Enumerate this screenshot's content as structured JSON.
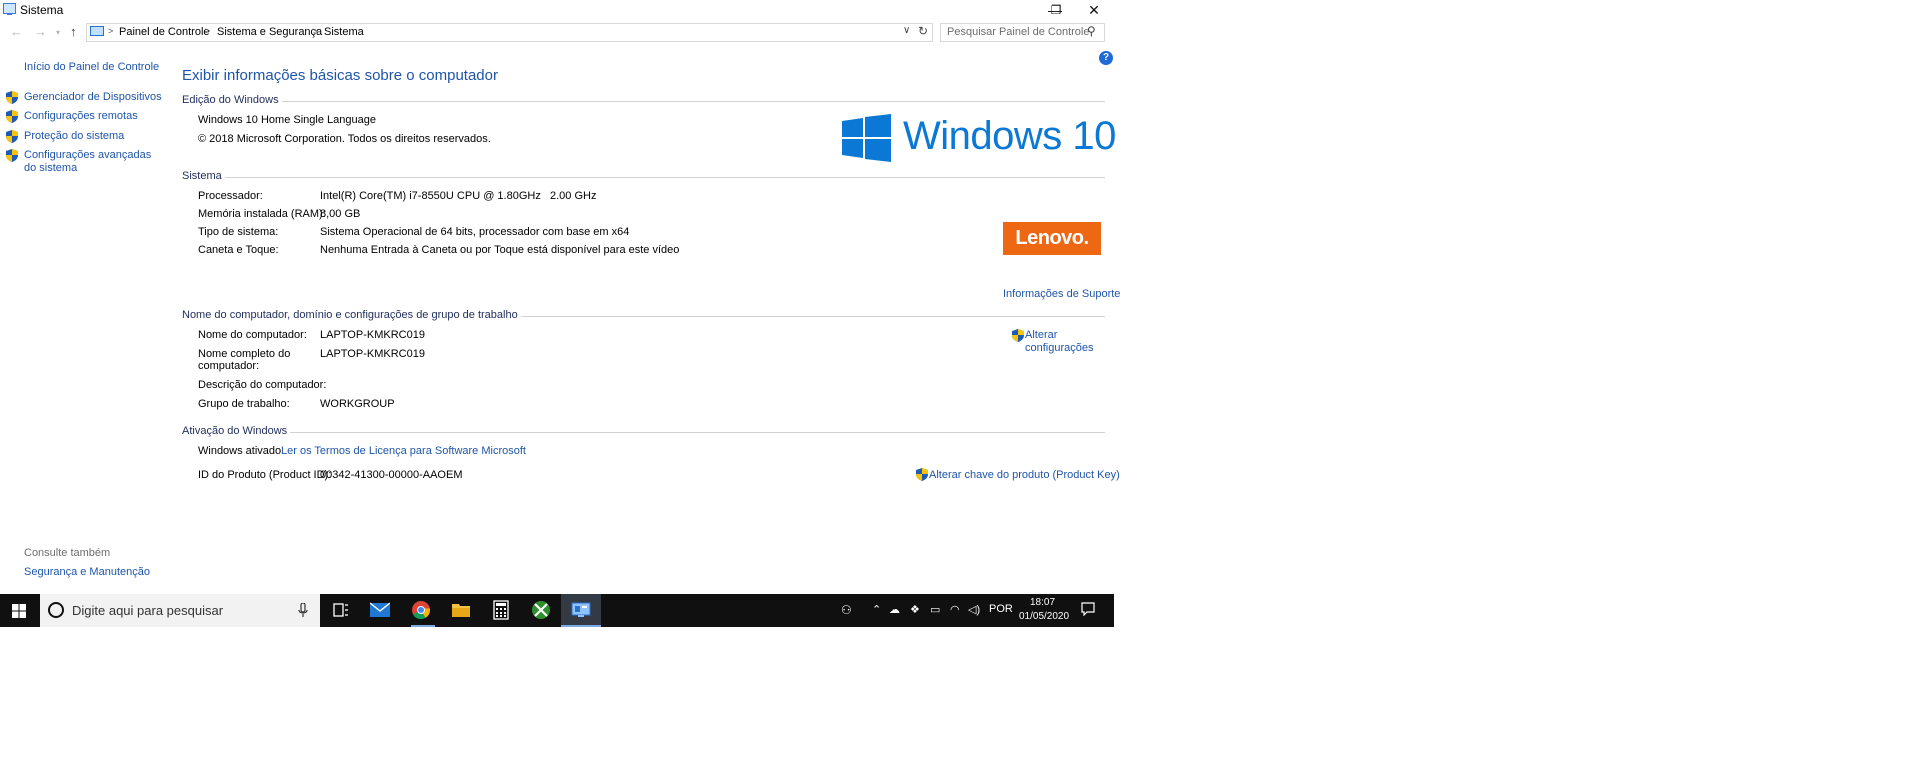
{
  "window": {
    "title": "Sistema",
    "minimize_glyph": "—",
    "restore_glyph": "❐",
    "close_glyph": "✕"
  },
  "address": {
    "crumbs": [
      "Painel de Controle",
      "Sistema e Segurança",
      "Sistema"
    ],
    "search_placeholder": "Pesquisar Painel de Controle"
  },
  "sidebar": {
    "home_link": "Início do Painel de Controle",
    "items": [
      {
        "label": "Gerenciador de Dispositivos"
      },
      {
        "label": "Configurações remotas"
      },
      {
        "label": "Proteção do sistema"
      },
      {
        "label": "Configurações avançadas do sistema"
      }
    ],
    "see_also_title": "Consulte também",
    "see_also_link": "Segurança e Manutenção"
  },
  "main": {
    "page_title": "Exibir informações básicas sobre o computador",
    "edition": {
      "section_title": "Edição do Windows",
      "name": "Windows 10 Home Single Language",
      "copyright": "© 2018 Microsoft Corporation. Todos os direitos reservados.",
      "logo_text": "Windows 10"
    },
    "system": {
      "section_title": "Sistema",
      "rows": [
        {
          "label": "Processador:",
          "value": "Intel(R) Core(TM) i7-8550U CPU @ 1.80GHz   2.00 GHz"
        },
        {
          "label": "Memória instalada (RAM):",
          "value": "8,00 GB"
        },
        {
          "label": "Tipo de sistema:",
          "value": "Sistema Operacional de 64 bits, processador com base em x64"
        },
        {
          "label": "Caneta e Toque:",
          "value": "Nenhuma Entrada à Caneta ou por Toque está disponível para este vídeo"
        }
      ],
      "oem_logo": "Lenovo.",
      "support_link": "Informações de Suporte"
    },
    "computer": {
      "section_title": "Nome do computador, domínio e configurações de grupo de trabalho",
      "rows": [
        {
          "label": "Nome do computador:",
          "value": "LAPTOP-KMKRC019"
        },
        {
          "label": "Nome completo do computador:",
          "value": "LAPTOP-KMKRC019"
        },
        {
          "label": "Descrição do computador:",
          "value": ""
        },
        {
          "label": "Grupo de trabalho:",
          "value": "WORKGROUP"
        }
      ],
      "change_settings": "Alterar configurações"
    },
    "activation": {
      "section_title": "Ativação do Windows",
      "status": "Windows ativado",
      "license_link": "Ler os Termos de Licença para Software Microsoft",
      "product_id_label": "ID do Produto (Product ID):",
      "product_id": "00342-41300-00000-AAOEM",
      "change_key": "Alterar chave do produto (Product Key)"
    }
  },
  "taskbar": {
    "search_text": "Digite aqui para pesquisar",
    "language": "POR",
    "time": "18:07",
    "date": "01/05/2020"
  },
  "colors": {
    "link": "#1f55a8",
    "windows_blue": "#0a78d4",
    "lenovo_orange": "#ee6712",
    "taskbar": "#101010"
  }
}
